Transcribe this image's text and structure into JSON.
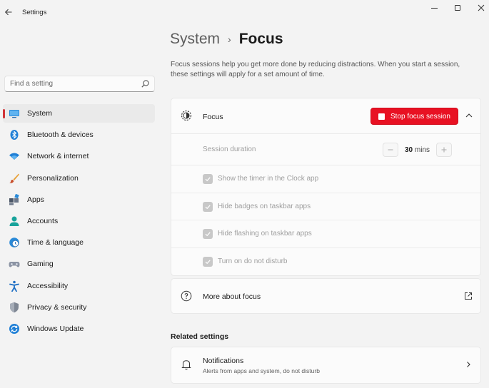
{
  "window": {
    "title": "Settings"
  },
  "search": {
    "placeholder": "Find a setting"
  },
  "sidebar": {
    "items": [
      {
        "label": "System",
        "icon": "system-icon",
        "active": true
      },
      {
        "label": "Bluetooth & devices",
        "icon": "bluetooth-icon"
      },
      {
        "label": "Network & internet",
        "icon": "wifi-icon"
      },
      {
        "label": "Personalization",
        "icon": "brush-icon"
      },
      {
        "label": "Apps",
        "icon": "apps-icon"
      },
      {
        "label": "Accounts",
        "icon": "account-icon"
      },
      {
        "label": "Time & language",
        "icon": "clock-globe-icon"
      },
      {
        "label": "Gaming",
        "icon": "gamepad-icon"
      },
      {
        "label": "Accessibility",
        "icon": "accessibility-icon"
      },
      {
        "label": "Privacy & security",
        "icon": "shield-icon"
      },
      {
        "label": "Windows Update",
        "icon": "update-icon"
      }
    ]
  },
  "main": {
    "breadcrumb_parent": "System",
    "breadcrumb_separator": "›",
    "breadcrumb_current": "Focus",
    "description": "Focus sessions help you get more done by reducing distractions. When you start a session, these settings will apply for a set amount of time.",
    "focus": {
      "title": "Focus",
      "stop_button_label": "Stop focus session",
      "duration_label": "Session duration",
      "duration_value": "30",
      "duration_unit": "mins",
      "options": [
        {
          "label": "Show the timer in the Clock app",
          "checked": true
        },
        {
          "label": "Hide badges on taskbar apps",
          "checked": true
        },
        {
          "label": "Hide flashing on taskbar apps",
          "checked": true
        },
        {
          "label": "Turn on do not disturb",
          "checked": true
        }
      ]
    },
    "more_about": "More about focus",
    "related_heading": "Related settings",
    "notifications": {
      "title": "Notifications",
      "subtitle": "Alerts from apps and system, do not disturb"
    }
  },
  "colors": {
    "accent": "#e81123",
    "active_indicator": "#d13438",
    "background": "#f3f3f3",
    "card": "#fbfbfb"
  }
}
